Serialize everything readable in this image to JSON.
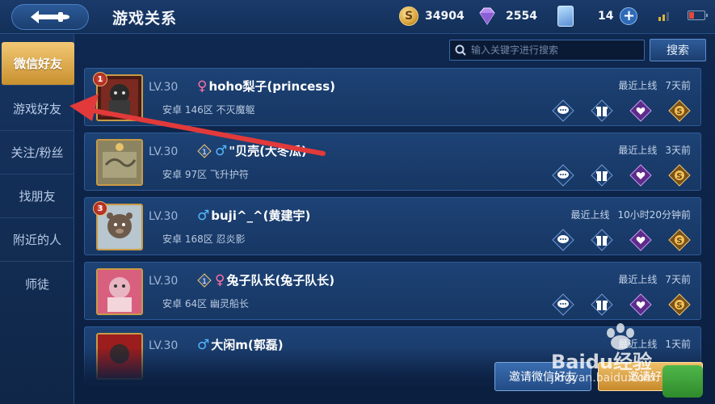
{
  "header": {
    "back_icon": "back-arrow-icon",
    "title": "游戏关系",
    "gold": "34904",
    "gems": "2554",
    "cards": "14",
    "plus": "+"
  },
  "sidebar": {
    "items": [
      {
        "label": "微信好友",
        "active": true
      },
      {
        "label": "游戏好友"
      },
      {
        "label": "关注/粉丝"
      },
      {
        "label": "找朋友"
      },
      {
        "label": "附近的人"
      },
      {
        "label": "师徒"
      }
    ]
  },
  "search": {
    "placeholder": "输入关键字进行搜索",
    "button": "搜索"
  },
  "friends": [
    {
      "rank": "1",
      "level": "LV.30",
      "gender": "♀",
      "name": "hoho梨子(princess)",
      "server": "安卓 146区 不灭魔躯",
      "online_label": "最近上线",
      "online_time": "7天前"
    },
    {
      "rank": "",
      "level": "LV.30",
      "gender": "♂",
      "name": "\"贝壳(大冬瓜)",
      "server": "安卓 97区 飞升护符",
      "online_label": "最近上线",
      "online_time": "3天前"
    },
    {
      "rank": "3",
      "level": "LV.30",
      "gender": "♂",
      "name": "buji^_^(黄建宇)",
      "server": "安卓 168区 忍炎影",
      "online_label": "最近上线",
      "online_time": "10小时20分钟前"
    },
    {
      "rank": "",
      "level": "LV.30",
      "gender": "♀",
      "name": "兔子队长(兔子队长)",
      "server": "安卓 64区 幽灵船长",
      "online_label": "最近上线",
      "online_time": "7天前"
    },
    {
      "rank": "",
      "level": "LV.30",
      "gender": "♂",
      "name": "大闲m(郭磊)",
      "server": "",
      "online_label": "最近上线",
      "online_time": "1天前"
    }
  ],
  "bottom": {
    "invite_wechat": "邀请微信好友",
    "invite_friend": "邀请好友"
  },
  "watermark": {
    "text": "Baidu经验",
    "sub": "jingyan.baidu.com"
  },
  "colors": {
    "accent_gold": "#c8902f",
    "female": "#ff6fa8",
    "male": "#52b7ff",
    "annotation_arrow": "#e23a3a"
  }
}
